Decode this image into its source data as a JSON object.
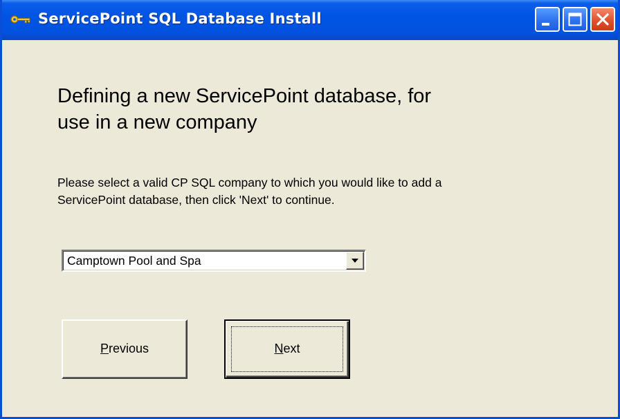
{
  "window": {
    "title": "ServicePoint SQL Database Install",
    "icons": {
      "app": "key-icon",
      "minimize": "minimize-icon",
      "maximize": "maximize-icon",
      "close": "close-icon"
    },
    "colors": {
      "titlebar": "#0054e3",
      "face": "#ece9d8",
      "close_button": "#e2512d"
    }
  },
  "main": {
    "heading_line1": "Defining a new ServicePoint database, for",
    "heading_line2": "use in a new company",
    "instructions_line1": "Please select a valid CP SQL company to which you would like to add a",
    "instructions_line2": "ServicePoint database, then click 'Next' to continue.",
    "company_select": {
      "selected": "Camptown Pool and Spa",
      "icon": "chevron-down-icon"
    },
    "buttons": {
      "previous": {
        "accel": "P",
        "rest": "revious"
      },
      "next": {
        "accel": "N",
        "rest": "ext"
      }
    }
  }
}
